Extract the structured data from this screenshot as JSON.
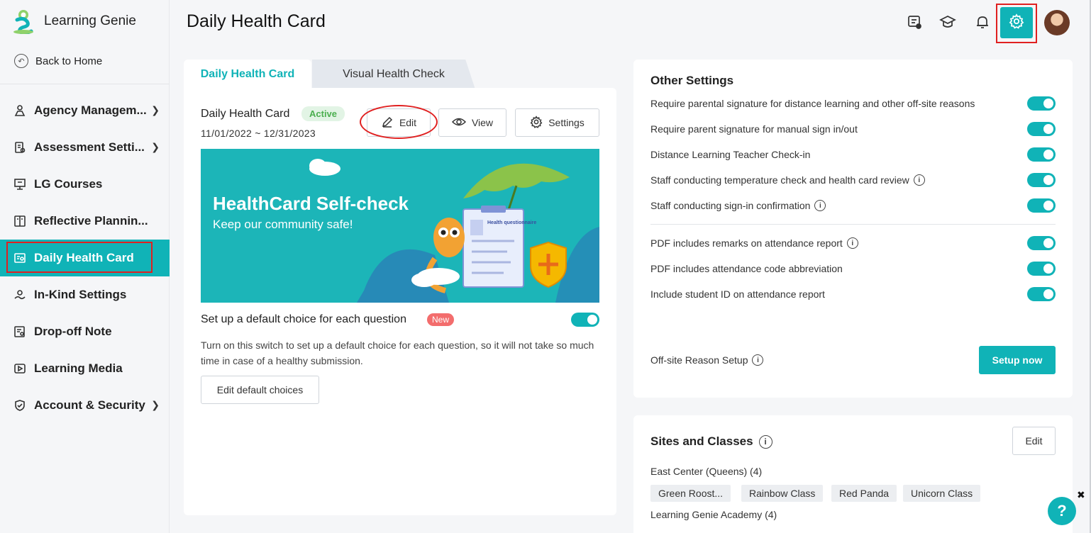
{
  "app": {
    "name": "Learning Genie",
    "back_label": "Back to Home"
  },
  "sidebar": {
    "items": [
      {
        "label": "Agency Managem...",
        "icon": "agency-icon",
        "has_chevron": true
      },
      {
        "label": "Assessment Setti...",
        "icon": "assessment-icon",
        "has_chevron": true
      },
      {
        "label": "LG Courses",
        "icon": "courses-icon",
        "has_chevron": false
      },
      {
        "label": "Reflective Plannin...",
        "icon": "planning-icon",
        "has_chevron": false
      },
      {
        "label": "Daily Health Card",
        "icon": "health-card-icon",
        "has_chevron": false,
        "active": true
      },
      {
        "label": "In-Kind Settings",
        "icon": "inkind-icon",
        "has_chevron": false
      },
      {
        "label": "Drop-off Note",
        "icon": "note-icon",
        "has_chevron": false
      },
      {
        "label": "Learning Media",
        "icon": "media-icon",
        "has_chevron": false
      },
      {
        "label": "Account & Security",
        "icon": "shield-icon",
        "has_chevron": true
      }
    ]
  },
  "header": {
    "title": "Daily Health Card"
  },
  "tabs": [
    {
      "label": "Daily Health Card",
      "active": true
    },
    {
      "label": "Visual Health Check",
      "active": false
    }
  ],
  "card": {
    "title": "Daily Health Card",
    "status": "Active",
    "date_range": "11/01/2022 ~ 12/31/2023",
    "edit_label": "Edit",
    "view_label": "View",
    "settings_label": "Settings",
    "banner_heading": "HealthCard Self-check",
    "banner_sub": "Keep our community safe!",
    "banner_doc_label": "Health questionnaire",
    "default_choice_label": "Set up a default choice for each question",
    "new_badge": "New",
    "default_choice_on": true,
    "description": "Turn on this switch to set up a default choice for each question, so it will not take so much time in case of a healthy submission.",
    "edit_default_label": "Edit default choices"
  },
  "other_settings": {
    "title": "Other Settings",
    "rows": [
      {
        "label": "Require parental signature for distance learning and other off-site reasons",
        "info": false,
        "on": true
      },
      {
        "label": "Require parent signature for manual sign in/out",
        "info": false,
        "on": true
      },
      {
        "label": "Distance Learning Teacher Check-in",
        "info": false,
        "on": true
      },
      {
        "label": "Staff conducting temperature check and health card review",
        "info": true,
        "on": true
      },
      {
        "label": "Staff conducting sign-in confirmation",
        "info": true,
        "on": true
      },
      {
        "label": "PDF includes remarks on attendance report",
        "info": true,
        "on": true
      },
      {
        "label": "PDF includes attendance code abbreviation",
        "info": false,
        "on": true
      },
      {
        "label": "Include student ID on attendance report",
        "info": false,
        "on": true
      }
    ],
    "offsite_label": "Off-site Reason Setup",
    "setup_label": "Setup now"
  },
  "sites": {
    "title": "Sites and Classes",
    "edit_label": "Edit",
    "groups": [
      {
        "name": "East Center (Queens) (4)",
        "classes": [
          "Green Roost...",
          "Rainbow Class",
          "Red Panda",
          "Unicorn Class"
        ]
      },
      {
        "name": "Learning Genie Academy (4)"
      }
    ]
  },
  "help": {
    "label": "?",
    "close": "✖"
  },
  "colors": {
    "accent": "#10b3b7",
    "highlight": "#e02020",
    "active_badge": "#4caf50",
    "new_badge": "#f36d6d"
  }
}
